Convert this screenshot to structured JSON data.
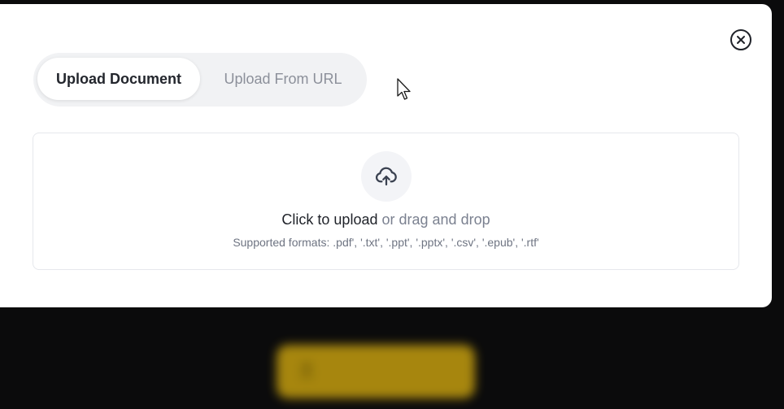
{
  "dialog": {
    "close_icon": "close-circle-icon",
    "tabs": [
      {
        "label": "Upload Document",
        "active": true
      },
      {
        "label": "Upload From URL",
        "active": false
      }
    ],
    "dropzone": {
      "icon": "cloud-upload-icon",
      "cta": "Click to upload",
      "secondary": "or drag and drop",
      "formats": "Supported formats: .pdf', '.txt', '.ppt', '.pptx', '.csv', '.epub', '.rtf'"
    }
  },
  "background": {
    "blurred_button_icon": "upload-icon",
    "blurred_button_color": "#b8940f"
  },
  "colors": {
    "tab_active_text": "#23262d",
    "tab_inactive_text": "#8c909a",
    "muted_text": "#7b8190"
  }
}
